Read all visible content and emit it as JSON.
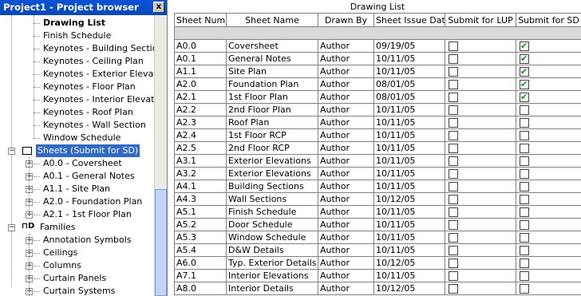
{
  "browser": {
    "title": "Project1 - Project browser",
    "close_label": "x",
    "schedules": [
      {
        "label": "Drawing List",
        "bold": true
      },
      {
        "label": "Finish Schedule"
      },
      {
        "label": "Keynotes - Building Section"
      },
      {
        "label": "Keynotes - Ceiling Plan"
      },
      {
        "label": "Keynotes - Exterior Elevation"
      },
      {
        "label": "Keynotes - Floor Plan"
      },
      {
        "label": "Keynotes - Interior Elevation"
      },
      {
        "label": "Keynotes - Roof Plan"
      },
      {
        "label": "Keynotes - Wall Section"
      },
      {
        "label": "Window Schedule"
      }
    ],
    "sheets_label": "Sheets (Submit for SD)",
    "sheets": [
      {
        "label": "A0.0 - Coversheet"
      },
      {
        "label": "A0.1 - General Notes"
      },
      {
        "label": "A1.1 - Site Plan"
      },
      {
        "label": "A2.0 - Foundation Plan"
      },
      {
        "label": "A2.1 - 1st Floor Plan"
      }
    ],
    "families_label": "Families",
    "families": [
      {
        "label": "Annotation Symbols"
      },
      {
        "label": "Ceilings"
      },
      {
        "label": "Columns"
      },
      {
        "label": "Curtain Panels"
      },
      {
        "label": "Curtain Systems"
      }
    ]
  },
  "schedule": {
    "title": "Drawing List",
    "headers": [
      "Sheet Number",
      "Sheet Name",
      "Drawn By",
      "Sheet Issue Date",
      "Submit for LUP",
      "Submit for SD"
    ],
    "rows": [
      {
        "num": "A0.0",
        "name": "Coversheet",
        "by": "Author",
        "date": "09/19/05",
        "lup": false,
        "sd": true
      },
      {
        "num": "A0.1",
        "name": "General Notes",
        "by": "Author",
        "date": "10/11/05",
        "lup": false,
        "sd": true
      },
      {
        "num": "A1.1",
        "name": "Site Plan",
        "by": "Author",
        "date": "10/11/05",
        "lup": false,
        "sd": true
      },
      {
        "num": "A2.0",
        "name": "Foundation Plan",
        "by": "Author",
        "date": "08/01/05",
        "lup": false,
        "sd": true
      },
      {
        "num": "A2.1",
        "name": "1st Floor Plan",
        "by": "Author",
        "date": "08/01/05",
        "lup": false,
        "sd": true
      },
      {
        "num": "A2.2",
        "name": "2nd Floor Plan",
        "by": "Author",
        "date": "10/11/05",
        "lup": false,
        "sd": false
      },
      {
        "num": "A2.3",
        "name": "Roof Plan",
        "by": "Author",
        "date": "10/11/05",
        "lup": false,
        "sd": false
      },
      {
        "num": "A2.4",
        "name": "1st Floor RCP",
        "by": "Author",
        "date": "10/11/05",
        "lup": false,
        "sd": false
      },
      {
        "num": "A2.5",
        "name": "2nd Floor RCP",
        "by": "Author",
        "date": "10/11/05",
        "lup": false,
        "sd": false
      },
      {
        "num": "A3.1",
        "name": "Exterior Elevations",
        "by": "Author",
        "date": "10/11/05",
        "lup": false,
        "sd": false
      },
      {
        "num": "A3.2",
        "name": "Exterior Elevations",
        "by": "Author",
        "date": "10/11/05",
        "lup": false,
        "sd": false
      },
      {
        "num": "A4.1",
        "name": "Building Sections",
        "by": "Author",
        "date": "10/11/05",
        "lup": false,
        "sd": false
      },
      {
        "num": "A4.3",
        "name": "Wall Sections",
        "by": "Author",
        "date": "10/12/05",
        "lup": false,
        "sd": false
      },
      {
        "num": "A5.1",
        "name": "Finish Schedule",
        "by": "Author",
        "date": "10/11/05",
        "lup": false,
        "sd": false
      },
      {
        "num": "A5.2",
        "name": "Door Schedule",
        "by": "Author",
        "date": "10/11/05",
        "lup": false,
        "sd": false
      },
      {
        "num": "A5.3",
        "name": "Window Schedule",
        "by": "Author",
        "date": "10/11/05",
        "lup": false,
        "sd": false
      },
      {
        "num": "A5.4",
        "name": "D&W Details",
        "by": "Author",
        "date": "10/11/05",
        "lup": false,
        "sd": false
      },
      {
        "num": "A6.0",
        "name": "Typ. Exterior Details",
        "by": "Author",
        "date": "10/12/05",
        "lup": false,
        "sd": false
      },
      {
        "num": "A7.1",
        "name": "Interior Elevations",
        "by": "Author",
        "date": "10/11/05",
        "lup": false,
        "sd": false
      },
      {
        "num": "A8.0",
        "name": "Interior Details",
        "by": "Author",
        "date": "10/12/05",
        "lup": false,
        "sd": false
      }
    ]
  },
  "colors": {
    "title_bar": "#0a52d6",
    "selection": "#316ac5",
    "check": "#1a8f1a"
  }
}
